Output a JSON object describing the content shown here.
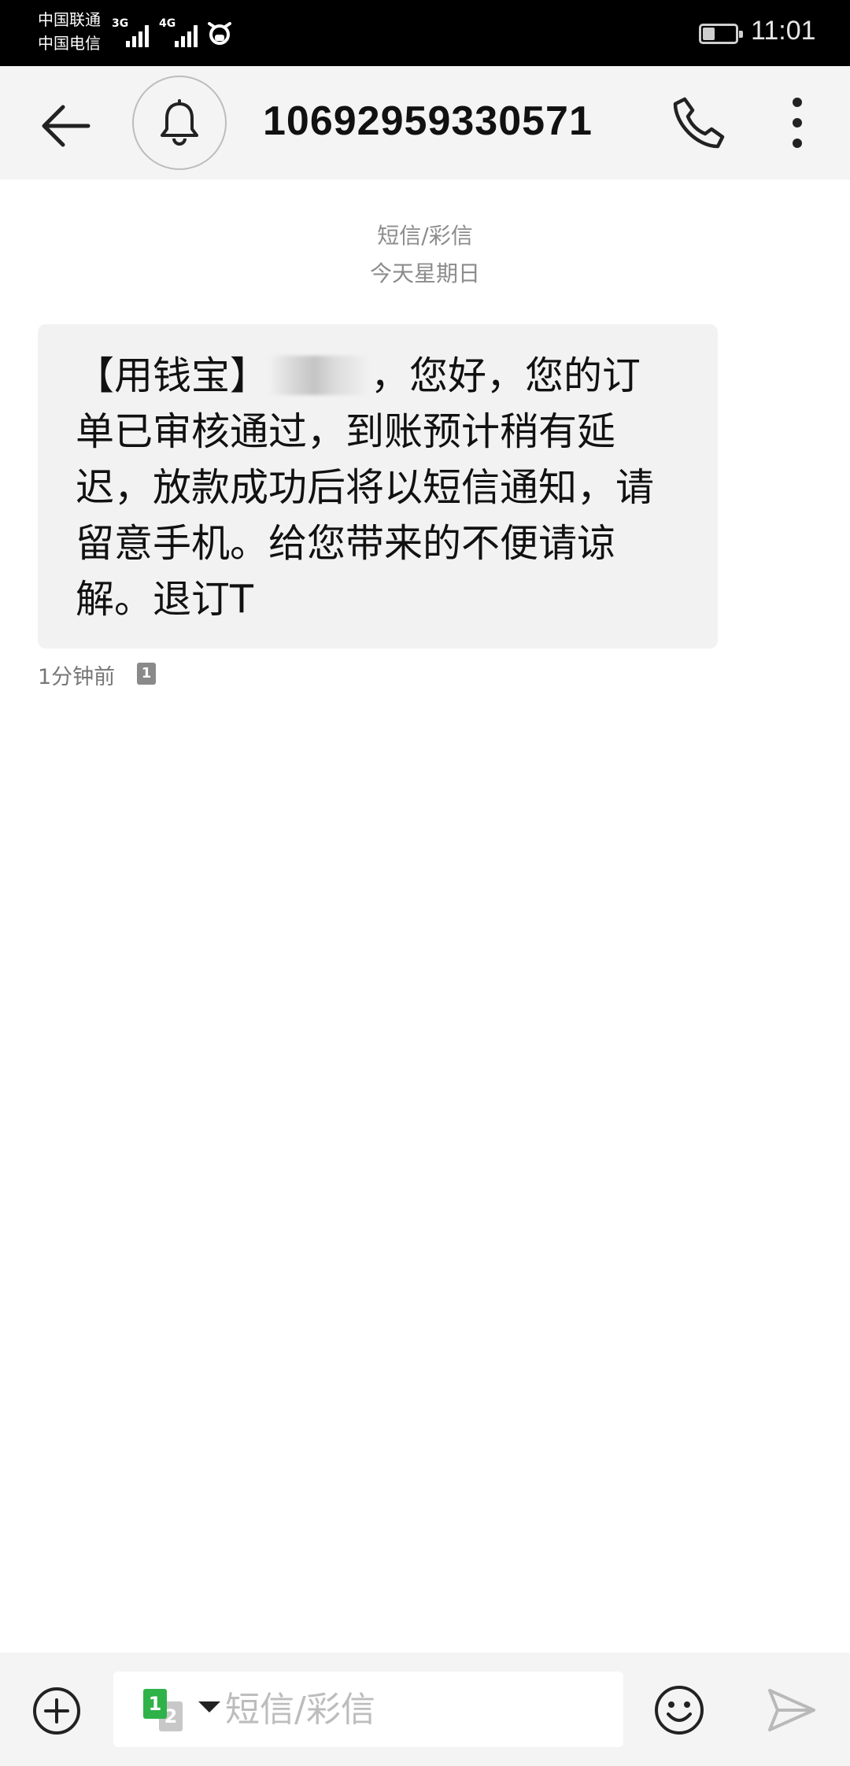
{
  "status_bar": {
    "carrier_1": "中国联通",
    "carrier_2": "中国电信",
    "network_1": "3G",
    "network_2": "4G",
    "battery_level": 0.35,
    "time": "11:01"
  },
  "header": {
    "contact_number": "10692959330571"
  },
  "conversation": {
    "message_type": "短信/彩信",
    "date_label": "今天星期日",
    "messages": [
      {
        "text_before": "【用钱宝】",
        "text_after": "，您好，您的订单已审核通过，到账预计稍有延迟，放款成功后将以短信通知，请留意手机。给您带来的不便请谅解。退订T",
        "time": "1分钟前",
        "sim": "1"
      }
    ]
  },
  "composer": {
    "sim_primary": "1",
    "sim_secondary": "2",
    "placeholder": "短信/彩信"
  },
  "icons": {
    "back": "arrow-left-icon",
    "notify": "bell-icon",
    "call": "phone-icon",
    "more": "more-vertical-icon",
    "add": "add-circle-icon",
    "emoji": "emoji-icon",
    "send": "send-icon"
  },
  "colors": {
    "status_bar_bg": "#000000",
    "header_bg": "#f4f4f4",
    "bubble_bg": "#f2f2f2",
    "sim1_green": "#2fb24a"
  }
}
